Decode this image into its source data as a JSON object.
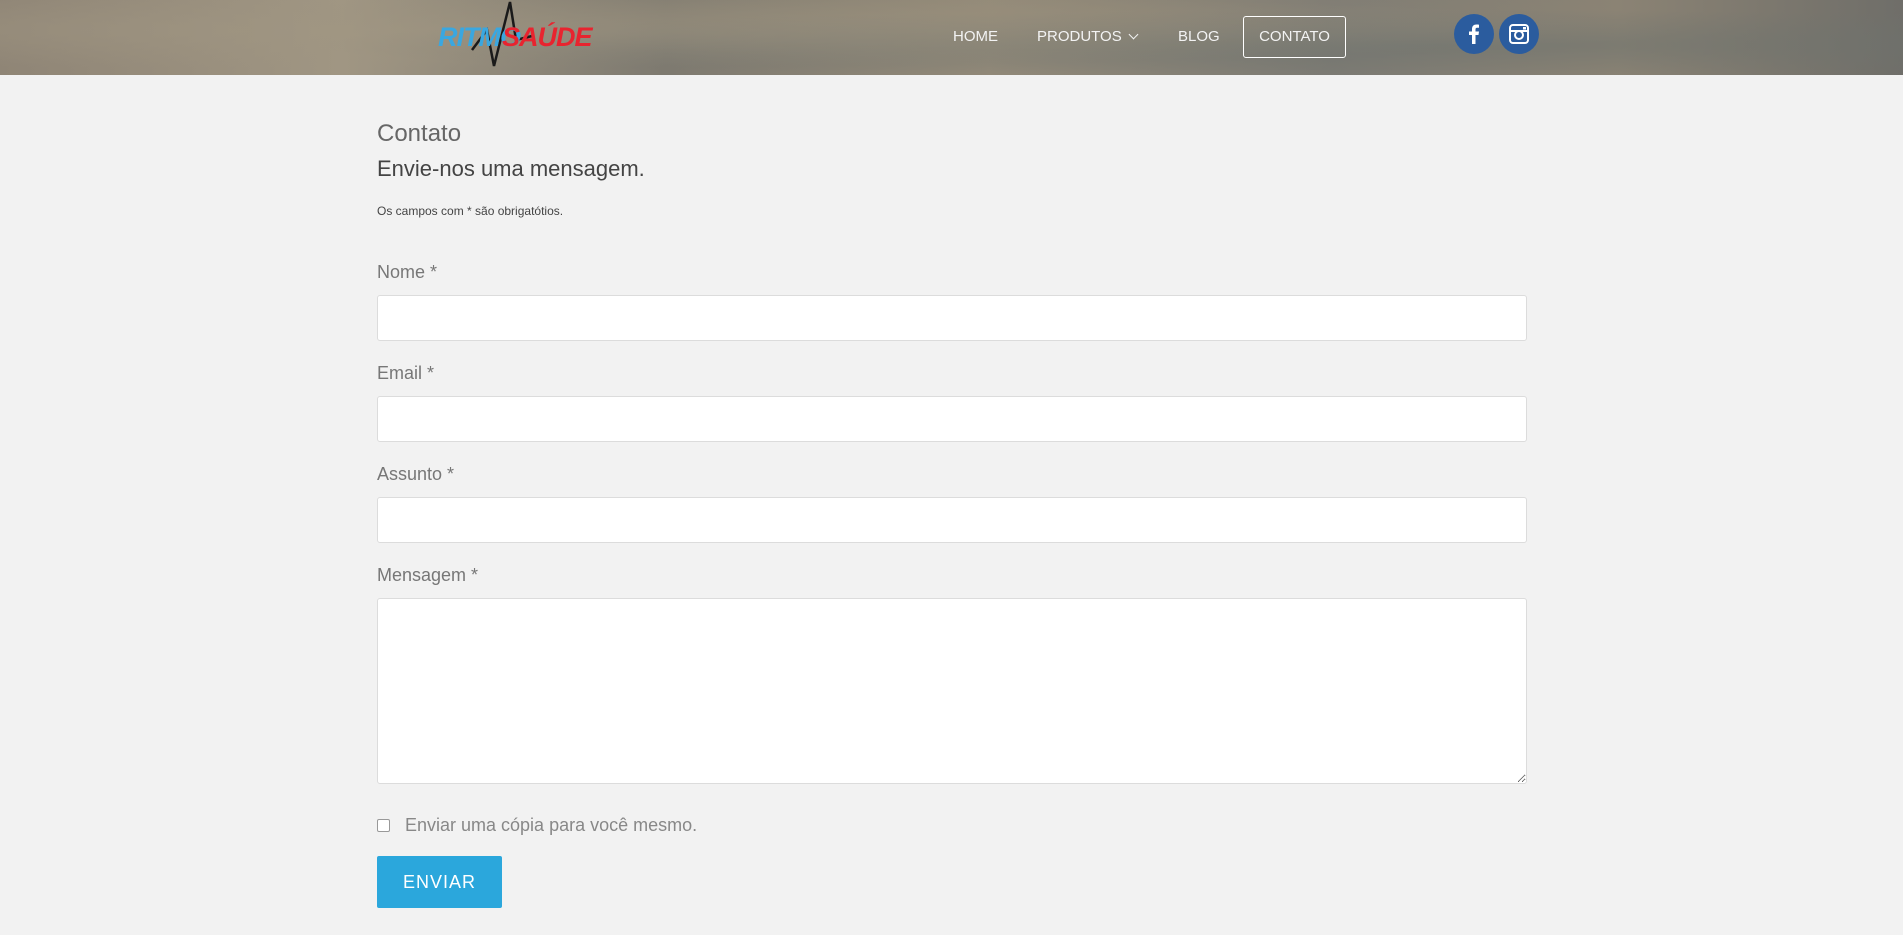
{
  "header": {
    "logo": {
      "part1": "RITMO",
      "part2": "SAÚDE"
    },
    "nav": {
      "home": "HOME",
      "produtos": "PRODUTOS",
      "blog": "BLOG",
      "contato": "CONTATO"
    },
    "social": [
      {
        "icon": "facebook-icon"
      },
      {
        "icon": "instagram-icon"
      }
    ]
  },
  "main": {
    "page_title": "Contato",
    "subtitle": "Envie-nos uma mensagem.",
    "required_note": "Os campos com * são obrigatótios.",
    "fields": {
      "nome": {
        "label": "Nome *",
        "value": ""
      },
      "email": {
        "label": "Email *",
        "value": ""
      },
      "assunto": {
        "label": "Assunto *",
        "value": ""
      },
      "mensagem": {
        "label": "Mensagem *",
        "value": ""
      }
    },
    "copy_checkbox": {
      "label": "Enviar uma cópia para você mesmo.",
      "checked": false
    },
    "submit_label": "ENVIAR"
  },
  "colors": {
    "accent": "#2ba7dc",
    "social": "#2b5c9e",
    "logo_blue": "#3aa7e0",
    "logo_red": "#e8242f",
    "background": "#f2f2f2"
  }
}
